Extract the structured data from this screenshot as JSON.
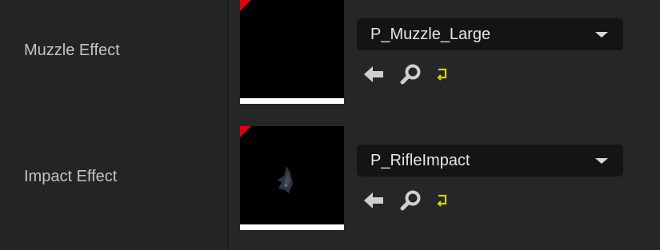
{
  "properties": [
    {
      "label": "Muzzle Effect",
      "value": "P_Muzzle_Large",
      "icons": [
        "use-selected-arrow-icon",
        "browse-magnifier-icon",
        "reset-to-default-icon"
      ]
    },
    {
      "label": "Impact Effect",
      "value": "P_RifleImpact",
      "icons": [
        "use-selected-arrow-icon",
        "browse-magnifier-icon",
        "reset-to-default-icon"
      ]
    }
  ],
  "colors": {
    "panel_bg": "#242424",
    "combo_bg": "#141414",
    "thumbnail_corner": "#e0000a",
    "reset_icon": "#d4d400",
    "icon_gray": "#cfcfcf"
  }
}
